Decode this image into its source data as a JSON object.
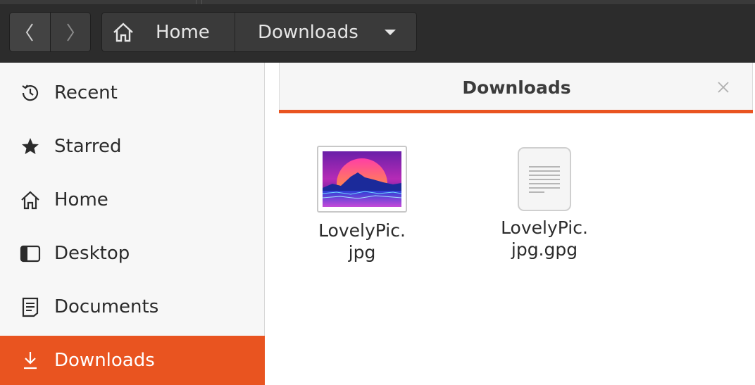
{
  "header": {
    "back_icon": "chevron-left-icon",
    "forward_icon": "chevron-right-icon",
    "path": [
      {
        "label": "Home",
        "icon": "home-icon"
      },
      {
        "label": "Downloads",
        "icon": "caret-down-icon"
      }
    ]
  },
  "sidebar": {
    "items": [
      {
        "label": "Recent",
        "icon": "clock-icon",
        "active": false
      },
      {
        "label": "Starred",
        "icon": "star-icon",
        "active": false
      },
      {
        "label": "Home",
        "icon": "home-icon",
        "active": false
      },
      {
        "label": "Desktop",
        "icon": "desktop-icon",
        "active": false
      },
      {
        "label": "Documents",
        "icon": "document-icon",
        "active": false
      },
      {
        "label": "Downloads",
        "icon": "download-icon",
        "active": true
      }
    ]
  },
  "tab": {
    "title": "Downloads",
    "close_icon": "close-icon"
  },
  "files": [
    {
      "name_line1": "LovelyPic.",
      "name_line2": "jpg",
      "type": "image-thumbnail"
    },
    {
      "name_line1": "LovelyPic.",
      "name_line2": "jpg.gpg",
      "type": "text-document-icon"
    }
  ],
  "colors": {
    "accent": "#e95420",
    "headerbar": "#2c2c2c",
    "sidebar": "#f7f7f7"
  }
}
